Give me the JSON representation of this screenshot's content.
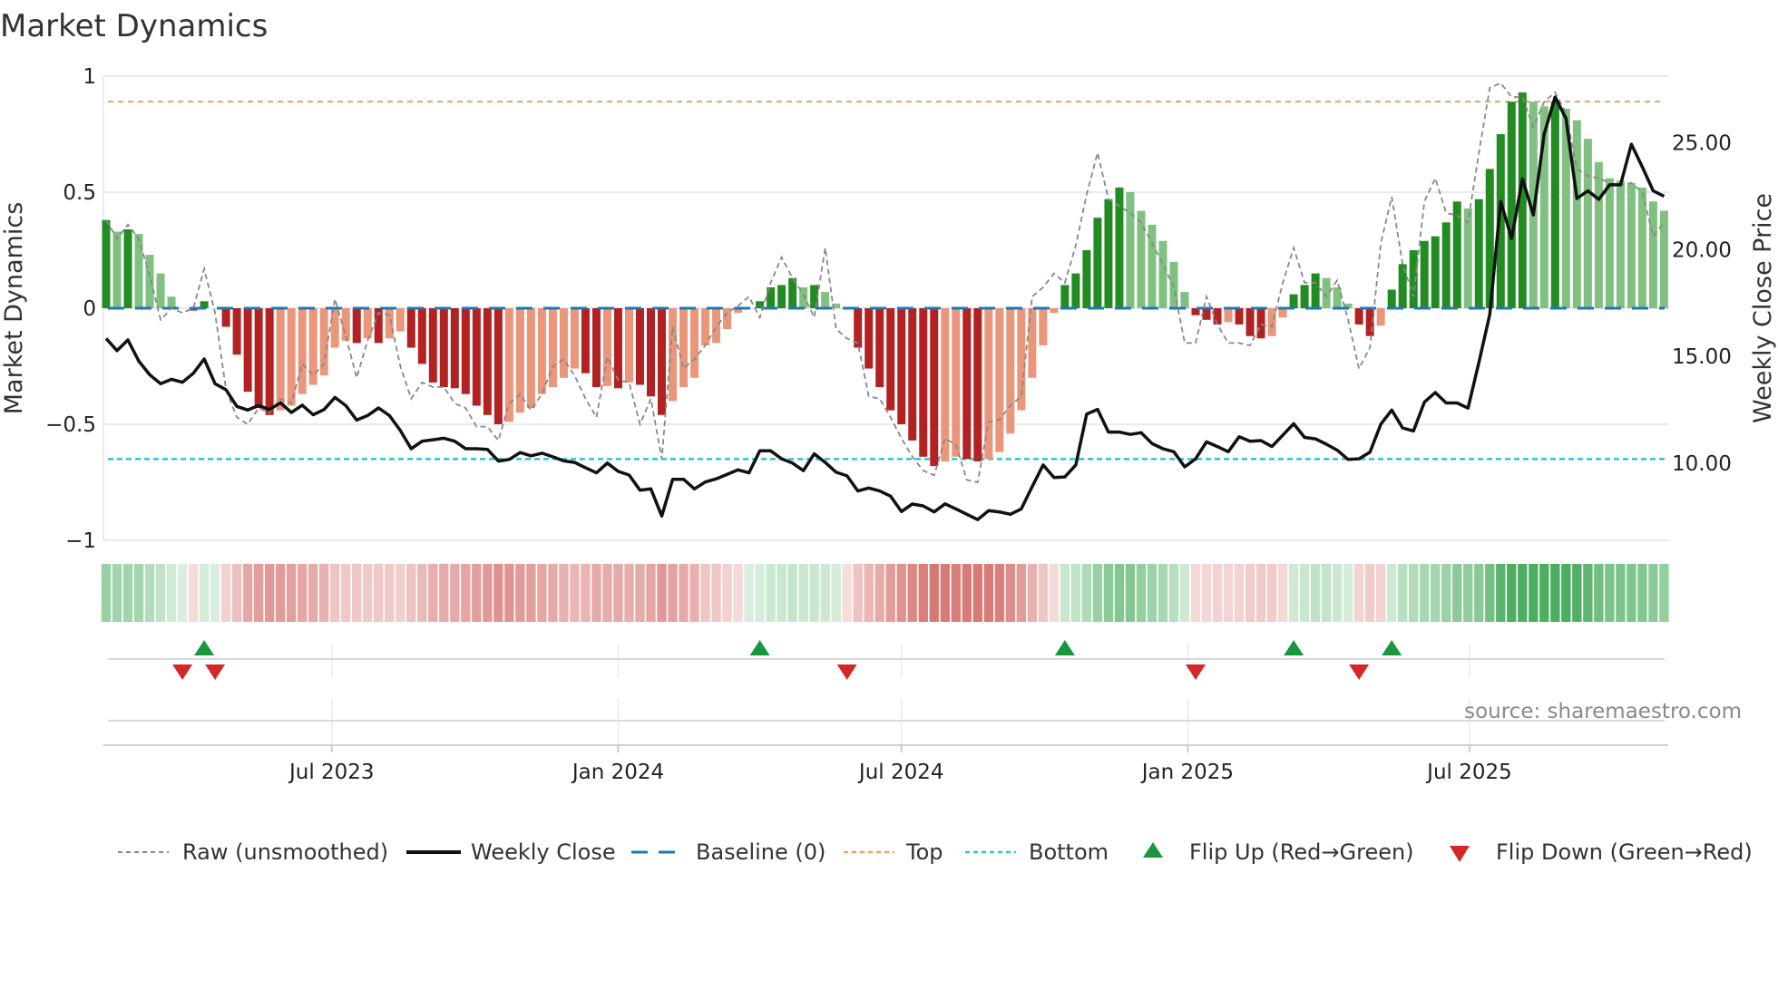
{
  "title": "Market Dynamics",
  "source": "source: sharemaestro.com",
  "colors": {
    "bar_up_strong": "#228b22",
    "bar_up_weak": "#80c080",
    "bar_down_strong": "#b22222",
    "bar_down_weak": "#e9967a",
    "raw": "#888888",
    "close": "#111111",
    "baseline": "#1f77b4",
    "top": "#f0a060",
    "bottom": "#2ec4d6",
    "flip_up": "#1a9641",
    "flip_down": "#d62728"
  },
  "chart_data": {
    "type": "bar",
    "title": "Market Dynamics",
    "xlabel": "",
    "ylabel": "Market Dynamics",
    "y2label": "Weekly Close Price",
    "ylim": [
      -1,
      1
    ],
    "y2lim": [
      10,
      25
    ],
    "yticks": [
      "1",
      "0.5",
      "0",
      "−0.5",
      "−1"
    ],
    "ytick_values": [
      1,
      0.5,
      0,
      -0.5,
      -1
    ],
    "y2ticks": [
      "25.00",
      "20.00",
      "15.00",
      "10.00"
    ],
    "y2tick_values": [
      25,
      20,
      15,
      10
    ],
    "xticks": [
      "Jul 2023",
      "Jan 2024",
      "Jul 2024",
      "Jan 2025",
      "Jul 2025"
    ],
    "xtick_dates": [
      "2023-07-01",
      "2024-01-01",
      "2024-07-01",
      "2025-01-01",
      "2025-07-01"
    ],
    "frequency": "weekly",
    "start_date": "2023-02-06",
    "top_level": 0.89,
    "bottom_level": -0.65,
    "baseline": 0,
    "grid": true,
    "legend_position": "bottom",
    "smoothed": [
      0.38,
      0.33,
      0.34,
      0.32,
      0.23,
      0.15,
      0.05,
      0,
      -0.01,
      0.03,
      0,
      -0.08,
      -0.2,
      -0.36,
      -0.43,
      -0.46,
      -0.44,
      -0.42,
      -0.37,
      -0.33,
      -0.29,
      -0.17,
      -0.14,
      -0.15,
      -0.13,
      -0.15,
      -0.13,
      -0.1,
      -0.17,
      -0.24,
      -0.32,
      -0.34,
      -0.345,
      -0.37,
      -0.42,
      -0.46,
      -0.5,
      -0.49,
      -0.45,
      -0.43,
      -0.37,
      -0.34,
      -0.3,
      -0.26,
      -0.28,
      -0.34,
      -0.335,
      -0.345,
      -0.32,
      -0.33,
      -0.38,
      -0.46,
      -0.4,
      -0.34,
      -0.3,
      -0.16,
      -0.15,
      -0.09,
      -0.02,
      0,
      0.03,
      0.09,
      0.1,
      0.13,
      0.09,
      0.1,
      0.07,
      0.02,
      -0.005,
      -0.17,
      -0.26,
      -0.34,
      -0.44,
      -0.5,
      -0.57,
      -0.64,
      -0.68,
      -0.66,
      -0.64,
      -0.65,
      -0.66,
      -0.65,
      -0.62,
      -0.54,
      -0.44,
      -0.3,
      -0.16,
      -0.02,
      0.1,
      0.15,
      0.25,
      0.39,
      0.47,
      0.52,
      0.5,
      0.42,
      0.36,
      0.29,
      0.2,
      0.07,
      -0.03,
      -0.05,
      -0.07,
      -0.06,
      -0.07,
      -0.12,
      -0.13,
      -0.12,
      -0.04,
      0.06,
      0.1,
      0.15,
      0.13,
      0.09,
      0.02,
      -0.07,
      -0.12,
      -0.075,
      0.08,
      0.19,
      0.25,
      0.29,
      0.31,
      0.37,
      0.46,
      0.43,
      0.47,
      0.6,
      0.75,
      0.89,
      0.93,
      0.89,
      0.87,
      0.89,
      0.86,
      0.81,
      0.73,
      0.63,
      0.56,
      0.55,
      0.54,
      0.52,
      0.46,
      0.42
    ],
    "raw": [
      0.38,
      0.3,
      0.36,
      0.3,
      0.14,
      -0.05,
      0,
      -0.02,
      0,
      0.17,
      -0.02,
      -0.35,
      -0.47,
      -0.5,
      -0.43,
      -0.45,
      -0.39,
      -0.41,
      -0.24,
      -0.29,
      -0.24,
      0.04,
      -0.12,
      -0.3,
      -0.14,
      -0.02,
      -0.03,
      -0.25,
      -0.39,
      -0.32,
      -0.34,
      -0.34,
      -0.41,
      -0.43,
      -0.51,
      -0.51,
      -0.57,
      -0.41,
      -0.37,
      -0.44,
      -0.37,
      -0.25,
      -0.22,
      -0.29,
      -0.39,
      -0.47,
      -0.21,
      -0.31,
      -0.32,
      -0.5,
      -0.39,
      -0.65,
      -0.08,
      -0.26,
      -0.22,
      -0.16,
      -0.08,
      -0.02,
      0.01,
      0.05,
      -0.04,
      0.11,
      0.22,
      0.13,
      0.06,
      -0.04,
      0.26,
      -0.09,
      -0.13,
      -0.15,
      -0.38,
      -0.39,
      -0.47,
      -0.56,
      -0.64,
      -0.7,
      -0.72,
      -0.56,
      -0.59,
      -0.74,
      -0.75,
      -0.49,
      -0.48,
      -0.42,
      -0.38,
      0.05,
      0.09,
      0.15,
      0.11,
      0.27,
      0.49,
      0.67,
      0.47,
      0.44,
      0.41,
      0.37,
      0.28,
      0.19,
      0.09,
      -0.15,
      -0.15,
      0.05,
      -0.07,
      -0.15,
      -0.15,
      -0.16,
      -0.07,
      -0.08,
      0.11,
      0.26,
      0.11,
      0.11,
      0.05,
      0.12,
      -0.05,
      -0.26,
      -0.17,
      0.28,
      0.48,
      0.19,
      0.05,
      0.46,
      0.56,
      0.41,
      0.4,
      0.37,
      0.67,
      0.95,
      0.97,
      0.91,
      0.91,
      0.78,
      0.89,
      0.93,
      0.84,
      0.6,
      0.57,
      0.56,
      0.54,
      0.53,
      0.54,
      0.5,
      0.31,
      0.37
    ],
    "weekly_close": [
      15.84,
      15.27,
      15.77,
      14.78,
      14.14,
      13.72,
      13.93,
      13.79,
      14.21,
      14.88,
      13.72,
      13.44,
      12.66,
      12.49,
      12.7,
      12.51,
      12.83,
      12.37,
      12.72,
      12.27,
      12.51,
      13.08,
      12.7,
      12.02,
      12.23,
      12.59,
      12.23,
      11.53,
      10.68,
      11.03,
      11.1,
      11.17,
      11.03,
      10.68,
      10.68,
      10.65,
      10.1,
      10.18,
      10.5,
      10.35,
      10.47,
      10.3,
      10.11,
      10.04,
      9.79,
      9.55,
      10.01,
      9.62,
      9.45,
      8.74,
      8.8,
      7.53,
      9.25,
      9.25,
      8.8,
      9.12,
      9.27,
      9.48,
      9.69,
      9.55,
      10.58,
      10.58,
      10.21,
      10.01,
      9.65,
      10.44,
      10.04,
      9.58,
      9.41,
      8.7,
      8.84,
      8.7,
      8.46,
      7.74,
      8.09,
      8.0,
      7.72,
      8.1,
      7.86,
      7.61,
      7.36,
      7.78,
      7.72,
      7.61,
      7.86,
      8.9,
      9.92,
      9.33,
      9.36,
      9.92,
      12.3,
      12.52,
      11.46,
      11.46,
      11.35,
      11.43,
      10.92,
      10.68,
      10.54,
      9.83,
      10.21,
      11.0,
      10.78,
      10.54,
      11.24,
      11.03,
      11.06,
      10.78,
      11.31,
      11.85,
      11.21,
      11.14,
      10.89,
      10.61,
      10.18,
      10.21,
      10.52,
      11.83,
      12.49,
      11.65,
      11.51,
      12.86,
      13.31,
      12.82,
      12.82,
      12.58,
      14.72,
      16.97,
      22.25,
      20.52,
      23.31,
      21.62,
      25.42,
      27.14,
      26.13,
      22.39,
      22.75,
      22.35,
      23.03,
      23.03,
      24.93,
      23.87,
      22.75,
      22.49
    ],
    "flips_up": [
      "2023-04-10",
      "2024-04-01",
      "2024-10-14",
      "2025-03-10",
      "2025-05-12"
    ],
    "flips_down": [
      "2023-03-27",
      "2023-04-17",
      "2024-05-27",
      "2025-01-06",
      "2025-04-21"
    ]
  },
  "legend": [
    {
      "label": "Raw (unsmoothed)"
    },
    {
      "label": "Weekly Close"
    },
    {
      "label": "Baseline (0)"
    },
    {
      "label": "Top"
    },
    {
      "label": "Bottom"
    },
    {
      "label": "Flip Up (Red→Green)"
    },
    {
      "label": "Flip Down (Green→Red)"
    }
  ]
}
